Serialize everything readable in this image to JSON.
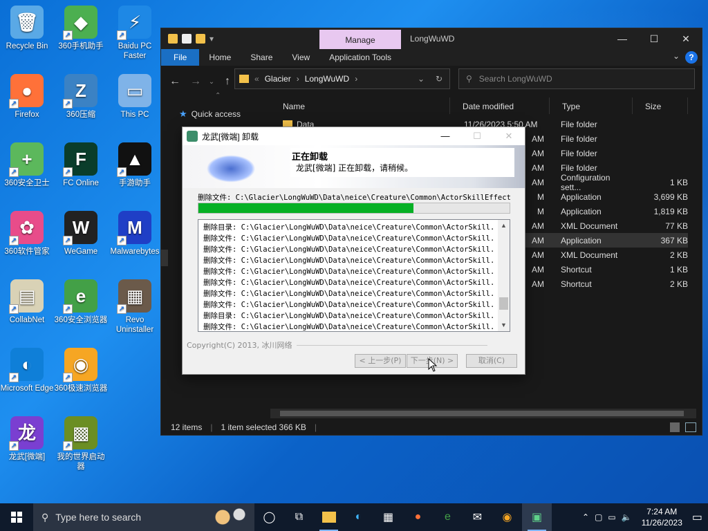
{
  "desktop": {
    "icons": [
      {
        "label": "Recycle Bin",
        "glyph": "🗑",
        "color": "#5aa9e6"
      },
      {
        "label": "360手机助手",
        "glyph": "◆",
        "color": "#4caf50"
      },
      {
        "label": "Baidu PC Faster",
        "glyph": "⚡",
        "color": "#1e88e5"
      },
      {
        "label": "Firefox",
        "glyph": "●",
        "color": "#ff7139"
      },
      {
        "label": "360压缩",
        "glyph": "Z",
        "color": "#3b82c4"
      },
      {
        "label": "This PC",
        "glyph": "▭",
        "color": "#7fb3e8"
      },
      {
        "label": "360安全卫士",
        "glyph": "+",
        "color": "#5cb85c"
      },
      {
        "label": "FC Online",
        "glyph": "F",
        "color": "#0a3d2b"
      },
      {
        "label": "手游助手",
        "glyph": "▲",
        "color": "#111111"
      },
      {
        "label": "360软件管家",
        "glyph": "✿",
        "color": "#e84c8a"
      },
      {
        "label": "WeGame",
        "glyph": "W",
        "color": "#222222"
      },
      {
        "label": "Malwarebytes",
        "glyph": "M",
        "color": "#1f3fc6"
      },
      {
        "label": "CollabNet",
        "glyph": "▤",
        "color": "#d9d2b6"
      },
      {
        "label": "360安全浏览器",
        "glyph": "e",
        "color": "#43a047"
      },
      {
        "label": "Revo Uninstaller",
        "glyph": "▦",
        "color": "#6b5a4a"
      },
      {
        "label": "Microsoft Edge",
        "glyph": "◐",
        "color": "#0f7fd8"
      },
      {
        "label": "360极速浏览器",
        "glyph": "◉",
        "color": "#f6a623"
      },
      {
        "label": "龙武[微端]",
        "glyph": "龙",
        "color": "#7a3fd1"
      },
      {
        "label": "我的世界启动器",
        "glyph": "▩",
        "color": "#6b8e23"
      }
    ]
  },
  "explorer": {
    "manage_tab": "Manage",
    "title": "LongWuWD",
    "controls": {
      "min": "—",
      "max": "☐",
      "close": "✕"
    },
    "ribbon_tabs": [
      "File",
      "Home",
      "Share",
      "View",
      "Application Tools"
    ],
    "address": {
      "sep": "«",
      "crumbs": [
        "Glacier",
        "LongWuWD"
      ],
      "chevron": "›"
    },
    "search_placeholder": "Search LongWuWD",
    "quick_access": "Quick access",
    "columns": {
      "name": "Name",
      "date": "Date modified",
      "type": "Type",
      "size": "Size"
    },
    "rows": [
      {
        "name": "Data",
        "date": "11/26/2023 5:50 AM",
        "type": "File folder",
        "size": ""
      },
      {
        "name": "",
        "date": "AM",
        "type": "File folder",
        "size": ""
      },
      {
        "name": "",
        "date": "AM",
        "type": "File folder",
        "size": ""
      },
      {
        "name": "",
        "date": "AM",
        "type": "File folder",
        "size": ""
      },
      {
        "name": "",
        "date": "AM",
        "type": "Configuration sett...",
        "size": "1 KB"
      },
      {
        "name": "",
        "date": "M",
        "type": "Application",
        "size": "3,699 KB"
      },
      {
        "name": "",
        "date": "M",
        "type": "Application",
        "size": "1,819 KB"
      },
      {
        "name": "",
        "date": "AM",
        "type": "XML Document",
        "size": "77 KB"
      },
      {
        "name": "",
        "date": "AM",
        "type": "Application",
        "size": "367 KB"
      },
      {
        "name": "",
        "date": "AM",
        "type": "XML Document",
        "size": "2 KB"
      },
      {
        "name": "",
        "date": "AM",
        "type": "Shortcut",
        "size": "1 KB"
      },
      {
        "name": "",
        "date": "AM",
        "type": "Shortcut",
        "size": "2 KB"
      }
    ],
    "selected_row": 8,
    "status": {
      "items": "12 items",
      "selected": "1 item selected  366 KB"
    }
  },
  "dialog": {
    "title": "龙武[微端] 卸载",
    "heading": "正在卸载",
    "subheading": "龙武[微端] 正在卸载，请稍候。",
    "current_file": "删除文件: C:\\Glacier\\LongWuWD\\Data\\neice\\Creature\\Common\\ActorSkillEffect\\f",
    "progress": 0.69,
    "log": [
      "删除目录: C:\\Glacier\\LongWuWD\\Data\\neice\\Creature\\Common\\ActorSkill...",
      "删除文件: C:\\Glacier\\LongWuWD\\Data\\neice\\Creature\\Common\\ActorSkill...",
      "删除文件: C:\\Glacier\\LongWuWD\\Data\\neice\\Creature\\Common\\ActorSkill...",
      "删除文件: C:\\Glacier\\LongWuWD\\Data\\neice\\Creature\\Common\\ActorSkill...",
      "删除文件: C:\\Glacier\\LongWuWD\\Data\\neice\\Creature\\Common\\ActorSkill...",
      "删除文件: C:\\Glacier\\LongWuWD\\Data\\neice\\Creature\\Common\\ActorSkill...",
      "删除文件: C:\\Glacier\\LongWuWD\\Data\\neice\\Creature\\Common\\ActorSkill...",
      "删除文件: C:\\Glacier\\LongWuWD\\Data\\neice\\Creature\\Common\\ActorSkill...",
      "删除目录: C:\\Glacier\\LongWuWD\\Data\\neice\\Creature\\Common\\ActorSkill...",
      "删除文件: C:\\Glacier\\LongWuWD\\Data\\neice\\Creature\\Common\\ActorSkill..."
    ],
    "copyright": "Copyright(C) 2013, 冰川网络",
    "buttons": {
      "back": "< 上一步(P)",
      "next": "下一步(N) >",
      "cancel": "取消(C)"
    }
  },
  "taskbar": {
    "search_placeholder": "Type here to search",
    "time": "7:24 AM",
    "date": "11/26/2023"
  }
}
